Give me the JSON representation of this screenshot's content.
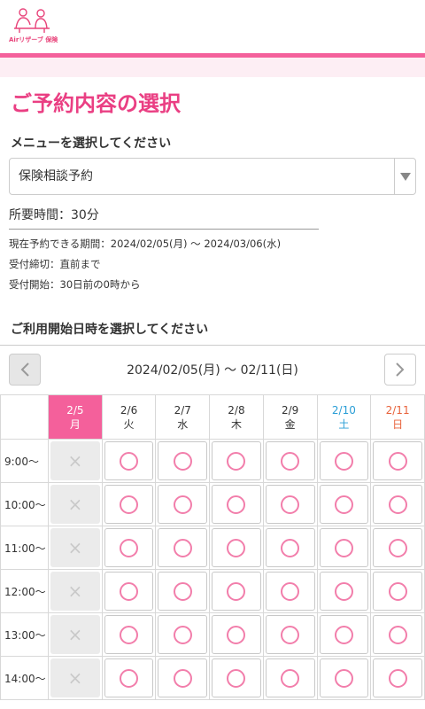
{
  "header": {
    "logo_text": "Airリザーブ 保険",
    "logo_icon": "people-consult-icon"
  },
  "page": {
    "title": "ご予約内容の選択"
  },
  "menu": {
    "label": "メニューを選択してください",
    "selected": "保険相談予約"
  },
  "duration": "所要時間：30分",
  "info": {
    "period": "現在予約できる期間：2024/02/05(月) 〜 2024/03/06(水)",
    "deadline": "受付締切：直前まで",
    "start": "受付開始：30日前の0時から"
  },
  "calendar": {
    "label": "ご利用開始日時を選択してください",
    "range": "2024/02/05(月) 〜 02/11(日)",
    "days": [
      {
        "date": "2/5",
        "dow": "月"
      },
      {
        "date": "2/6",
        "dow": "火"
      },
      {
        "date": "2/7",
        "dow": "水"
      },
      {
        "date": "2/8",
        "dow": "木"
      },
      {
        "date": "2/9",
        "dow": "金"
      },
      {
        "date": "2/10",
        "dow": "土"
      },
      {
        "date": "2/11",
        "dow": "日"
      }
    ],
    "times": [
      "9:00〜",
      "10:00〜",
      "11:00〜",
      "12:00〜",
      "13:00〜",
      "14:00〜"
    ],
    "availability": [
      [
        "×",
        "○",
        "○",
        "○",
        "○",
        "○",
        "○"
      ],
      [
        "×",
        "○",
        "○",
        "○",
        "○",
        "○",
        "○"
      ],
      [
        "×",
        "○",
        "○",
        "○",
        "○",
        "○",
        "○"
      ],
      [
        "×",
        "○",
        "○",
        "○",
        "○",
        "○",
        "○"
      ],
      [
        "×",
        "○",
        "○",
        "○",
        "○",
        "○",
        "○"
      ],
      [
        "×",
        "○",
        "○",
        "○",
        "○",
        "○",
        "○"
      ]
    ],
    "colors": {
      "accent": "#f4609b",
      "saturday": "#2a9ed6",
      "sunday": "#e8623b",
      "available": "#f27eab"
    }
  }
}
